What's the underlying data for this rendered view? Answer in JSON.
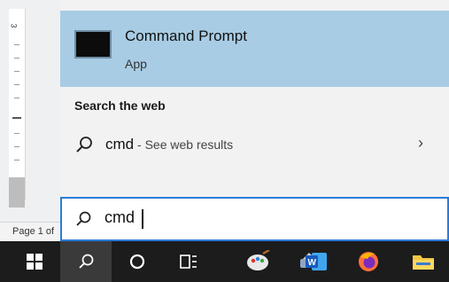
{
  "document": {
    "ruler_number": "3",
    "status_page": "Page 1 of"
  },
  "best_match": {
    "title": "Command Prompt",
    "subtitle": "App",
    "icon": "command-prompt-icon"
  },
  "web_section": {
    "heading": "Search the web",
    "query": "cmd",
    "hint": " - See web results",
    "chevron": "›"
  },
  "search": {
    "value": "cmd",
    "icon": "search-icon"
  },
  "taskbar": {
    "items": [
      {
        "name": "start-button",
        "icon": "windows-logo-icon"
      },
      {
        "name": "search-button",
        "icon": "search-icon",
        "active": true
      },
      {
        "name": "cortana-button",
        "icon": "circle-icon"
      },
      {
        "name": "task-view-button",
        "icon": "task-view-icon"
      },
      {
        "name": "paint-app",
        "icon": "paint-palette-icon"
      },
      {
        "name": "tools-app",
        "icon": "tools-icon"
      },
      {
        "name": "word-app",
        "icon": "word-icon"
      },
      {
        "name": "firefox-app",
        "icon": "firefox-icon"
      },
      {
        "name": "file-explorer-app",
        "icon": "folder-icon"
      }
    ]
  },
  "colors": {
    "highlight": "#a8cce4",
    "accent": "#2b7bd8",
    "taskbar": "#1c1c1c"
  }
}
